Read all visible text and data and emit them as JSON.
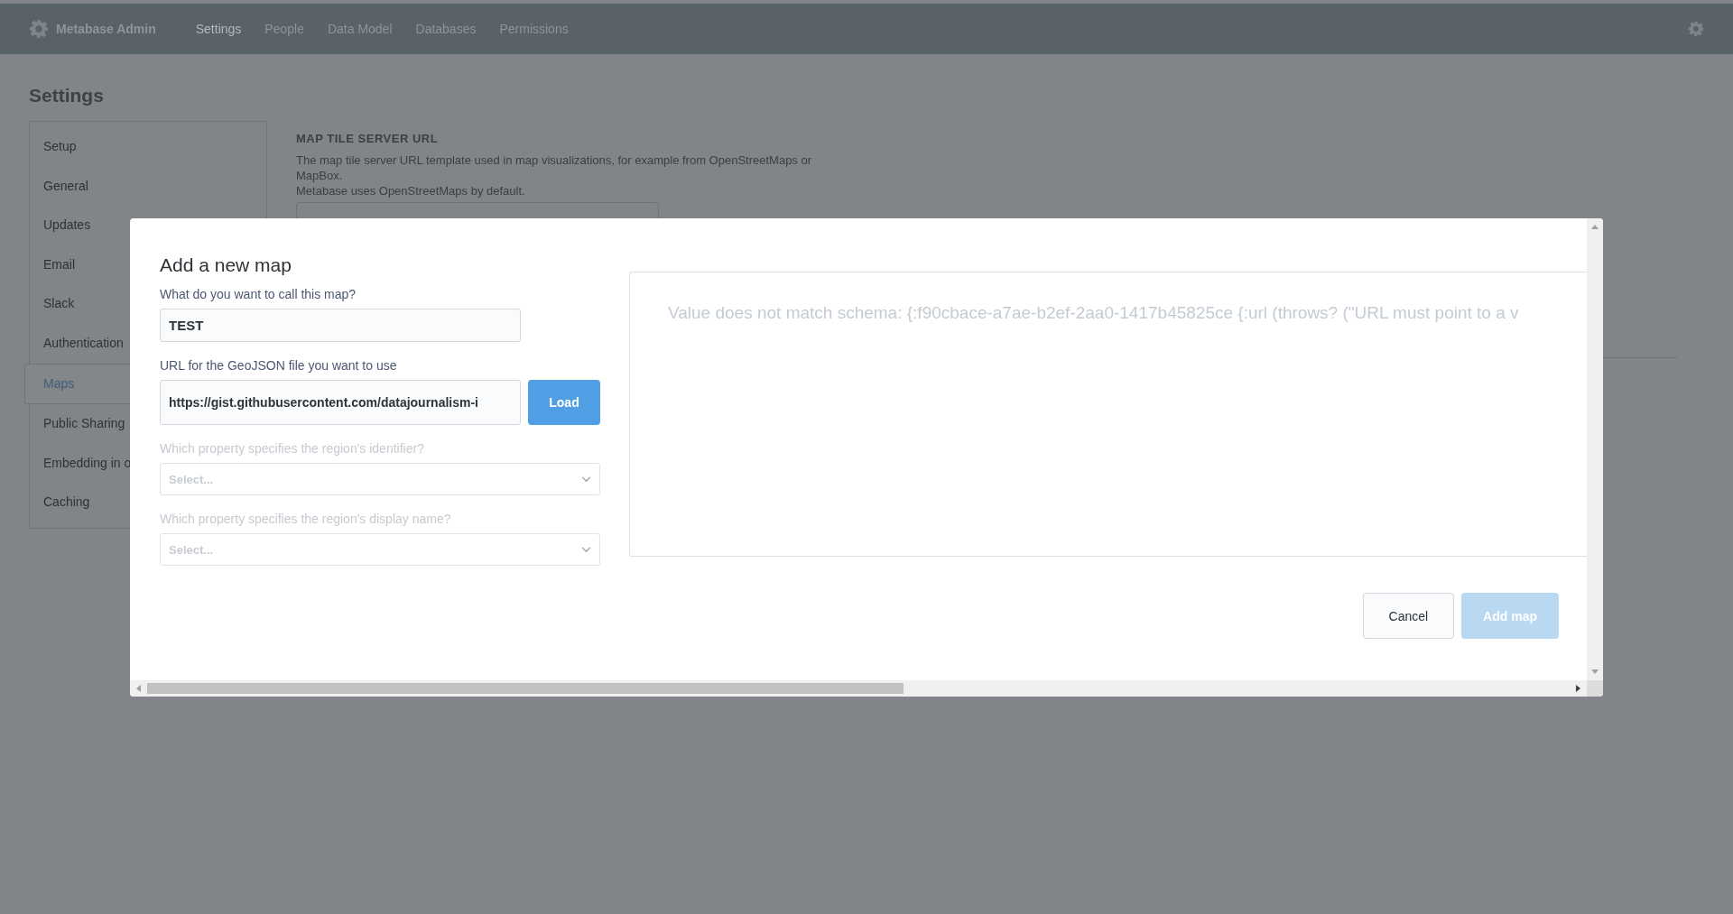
{
  "nav": {
    "brand": "Metabase Admin",
    "tabs": [
      {
        "label": "Settings",
        "selected": true
      },
      {
        "label": "People",
        "selected": false
      },
      {
        "label": "Data Model",
        "selected": false
      },
      {
        "label": "Databases",
        "selected": false
      },
      {
        "label": "Permissions",
        "selected": false
      }
    ]
  },
  "page": {
    "title": "Settings",
    "sidebar": [
      {
        "label": "Setup",
        "selected": false
      },
      {
        "label": "General",
        "selected": false
      },
      {
        "label": "Updates",
        "selected": false
      },
      {
        "label": "Email",
        "selected": false
      },
      {
        "label": "Slack",
        "selected": false
      },
      {
        "label": "Authentication",
        "selected": false
      },
      {
        "label": "Maps",
        "selected": true
      },
      {
        "label": "Public Sharing",
        "selected": false
      },
      {
        "label": "Embedding in o",
        "selected": false
      },
      {
        "label": "Caching",
        "selected": false
      }
    ],
    "setting": {
      "heading": "MAP TILE SERVER URL",
      "description": "The map tile server URL template used in map visualizations, for example from OpenStreetMaps or MapBox.",
      "note": "Metabase uses OpenStreetMaps by default."
    }
  },
  "modal": {
    "title": "Add a new map",
    "fields": [
      {
        "kind": "text",
        "label": "What do you want to call this map?",
        "value": "TEST",
        "disabled": false
      },
      {
        "kind": "url",
        "label": "URL for the GeoJSON file you want to use",
        "value": "https://gist.githubusercontent.com/datajournalism-i",
        "button": "Load",
        "disabled": false
      },
      {
        "kind": "select",
        "label": "Which property specifies the region's identifier?",
        "placeholder": "Select...",
        "disabled": true
      },
      {
        "kind": "select",
        "label": "Which property specifies the region's display name?",
        "placeholder": "Select...",
        "disabled": true
      }
    ],
    "preview": {
      "message": "Value does not match schema: {:f90cbace-a7ae-b2ef-2aa0-1417b45825ce {:url (throws? (\"URL must point to a v"
    },
    "buttons": [
      {
        "label": "Cancel",
        "kind": "secondary",
        "disabled": false
      },
      {
        "label": "Add map",
        "kind": "primary",
        "disabled": true
      }
    ]
  }
}
